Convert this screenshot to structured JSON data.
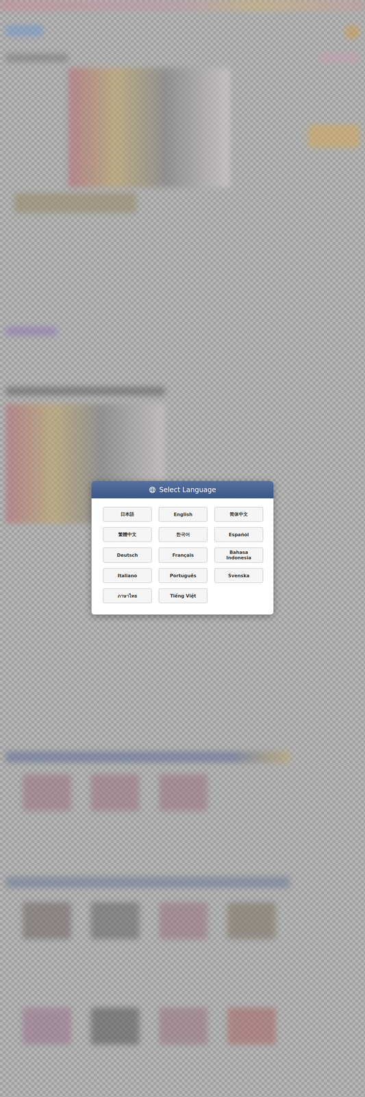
{
  "dialog": {
    "title": "Select Language",
    "languages": [
      {
        "label": "日本語"
      },
      {
        "label": "English"
      },
      {
        "label": "简体中文"
      },
      {
        "label": "繁體中文"
      },
      {
        "label": "한국어"
      },
      {
        "label": "Español"
      },
      {
        "label": "Deutsch"
      },
      {
        "label": "Français"
      },
      {
        "label": "Bahasa Indonesia"
      },
      {
        "label": "Italiano"
      },
      {
        "label": "Português"
      },
      {
        "label": "Svenska"
      },
      {
        "label": "ภาษาไทย"
      },
      {
        "label": "Tiếng Việt"
      }
    ]
  }
}
